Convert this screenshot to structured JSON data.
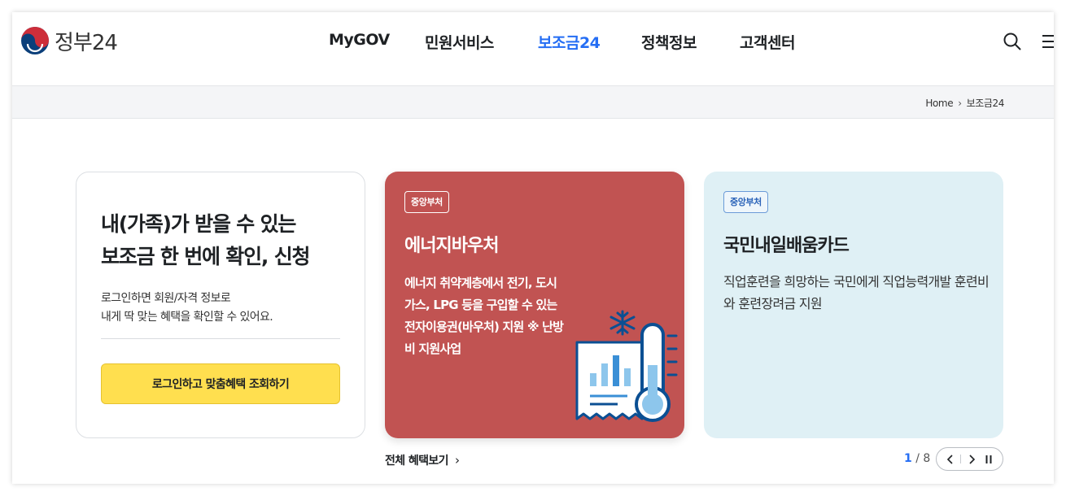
{
  "header": {
    "logo_text": "정부24",
    "nav": [
      {
        "label": "MyGOV",
        "active": false
      },
      {
        "label": "민원서비스",
        "active": false
      },
      {
        "label": "보조금24",
        "active": true
      },
      {
        "label": "정책정보",
        "active": false
      },
      {
        "label": "고객센터",
        "active": false
      }
    ]
  },
  "breadcrumb": {
    "home": "Home",
    "current": "보조금24"
  },
  "login_card": {
    "title_line1": "내(가족)가 받을 수 있는",
    "title_line2": "보조금 한 번에 확인, 신청",
    "desc_line1": "로그인하면 회원/자격 정보로",
    "desc_line2": "내게 딱 맞는 혜택을 확인할 수 있어요.",
    "button_label": "로그인하고 맞춤혜택 조회하기"
  },
  "cards": [
    {
      "tag": "중앙부처",
      "title": "에너지바우처",
      "description": "에너지 취약계층에서 전기, 도시가스, LPG 등을 구입할 수 있는 전자이용권(바우처) 지원 ※ 난방비 지원사업",
      "icon": "energy-thermometer-icon",
      "color": "#c15352"
    },
    {
      "tag": "중앙부처",
      "title": "국민내일배움카드",
      "description": "직업훈련을 희망하는 국민에게 직업능력개발 훈련비와 훈련장려금 지원",
      "color": "#dff0f5"
    }
  ],
  "footer": {
    "all_benefits_label": "전체 혜택보기",
    "page_current": "1",
    "page_separator": "/",
    "page_total": "8"
  },
  "colors": {
    "accent": "#256ef4",
    "login_button": "#ffdf4f"
  }
}
